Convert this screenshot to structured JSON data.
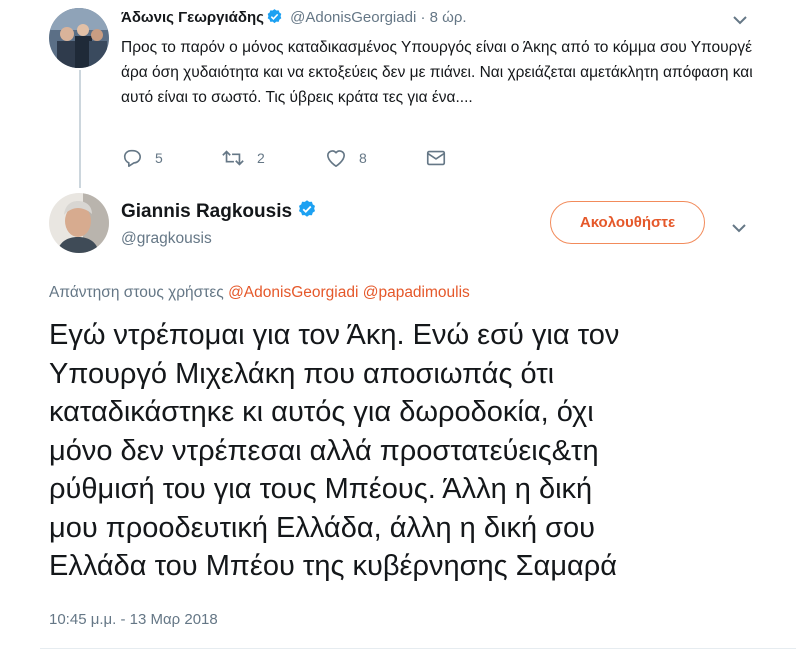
{
  "colors": {
    "accent": "#e5582a",
    "muted": "#657786",
    "text": "#14171a",
    "verified": "#1da1f2"
  },
  "reply_tweet": {
    "name": "Άδωνις Γεωργιάδης",
    "handle": "@AdonisGeorgiadi",
    "separator": "·",
    "time": "8 ώρ.",
    "text": "Προς το παρόν ο μόνος καταδικασμένος Υπουργός είναι ο Άκης από το κόμμα σου Υπουργέ άρα όση χυδαιότητα και να εκτοξεύεις δεν με πιάνει. Ναι χρειάζεται αμετάκλητη απόφαση και αυτό είναι το σωστό. Τις ύβρεις κράτα τες για ένα....",
    "replies": "5",
    "retweets": "2",
    "likes": "8"
  },
  "main_tweet": {
    "name": "Giannis Ragkousis",
    "handle": "@gragkousis",
    "follow_label": "Ακολουθήστε",
    "reply_prefix": "Απάντηση στους χρήστες",
    "mention1": "@AdonisGeorgiadi",
    "mention2": "@papadimoulis",
    "lines": [
      "Εγώ ντρέπομαι για τον Άκη. Ενώ εσύ για τον",
      "Υπουργό Μιχελάκη που αποσιωπάς ότι",
      "καταδικάστηκε κι αυτός για δωροδοκία, όχι",
      "μόνο δεν ντρέπεσαι αλλά προστατεύεις&τη",
      "ρύθμισή του για τους Μπέους. Άλλη η δική",
      "μου προοδευτική Ελλάδα, άλλη η δική σου",
      "Ελλάδα του Μπέου της κυβέρνησης Σαμαρά"
    ],
    "timestamp": "10:45 μ.μ. - 13 Μαρ 2018"
  },
  "icons": [
    "reply-icon",
    "retweet-icon",
    "like-icon",
    "dm-icon",
    "verified-icon",
    "chevron-down-icon"
  ]
}
